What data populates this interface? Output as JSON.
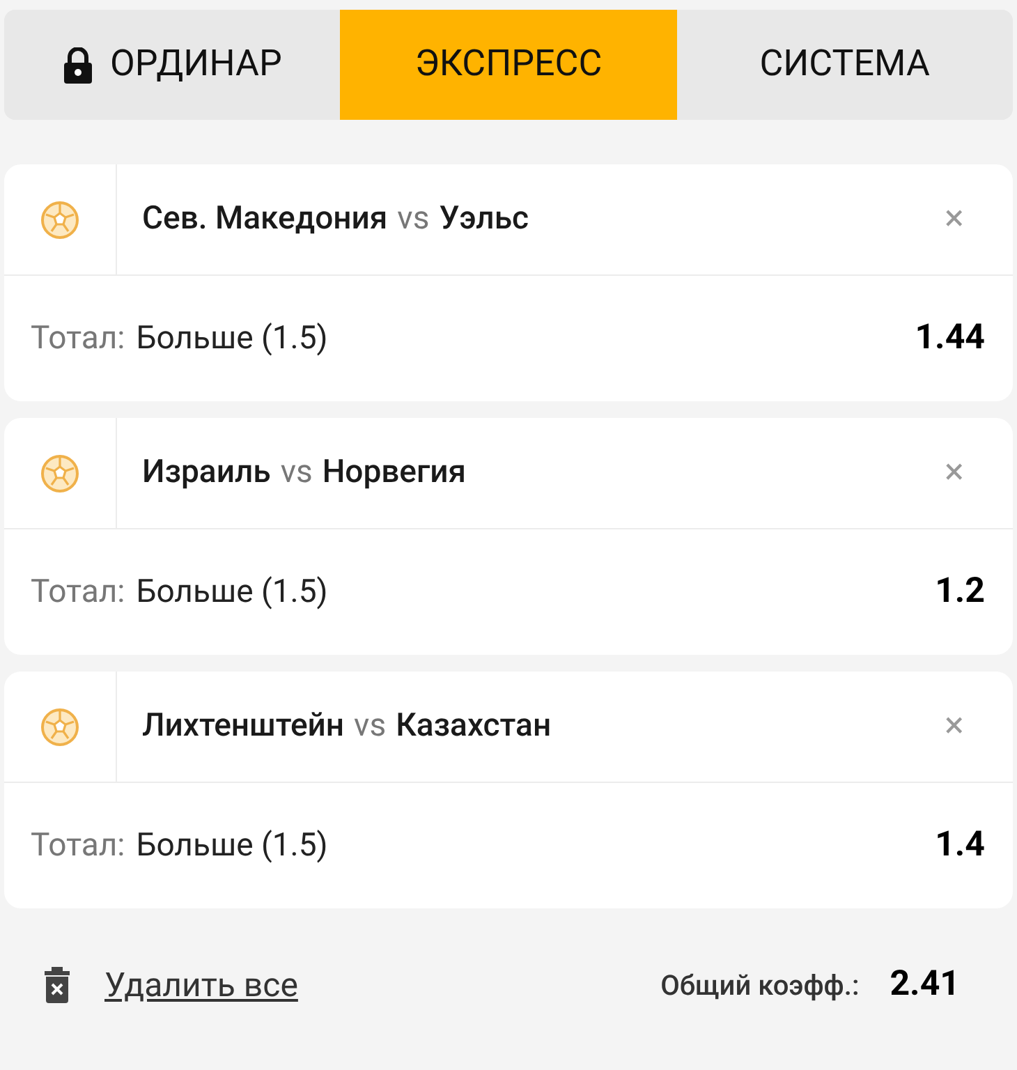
{
  "tabs": [
    {
      "label": "ОРДИНАР",
      "locked": true,
      "selected": false
    },
    {
      "label": "ЭКСПРЕСС",
      "locked": false,
      "selected": true
    },
    {
      "label": "СИСТЕМА",
      "locked": false,
      "selected": false
    }
  ],
  "bets": [
    {
      "home": "Сев. Македония",
      "separator": "vs",
      "away": "Уэльс",
      "market": "Тотал:",
      "selection": "Больше (1.5)",
      "odds": "1.44",
      "remove": "×"
    },
    {
      "home": "Израиль",
      "separator": "vs",
      "away": "Норвегия",
      "market": "Тотал:",
      "selection": "Больше (1.5)",
      "odds": "1.2",
      "remove": "×"
    },
    {
      "home": "Лихтенштейн",
      "separator": "vs",
      "away": "Казахстан",
      "market": "Тотал:",
      "selection": "Больше (1.5)",
      "odds": "1.4",
      "remove": "×"
    }
  ],
  "footer": {
    "delete_all": "Удалить все",
    "total_label": "Общий коэфф.:",
    "total_odds": "2.41"
  }
}
